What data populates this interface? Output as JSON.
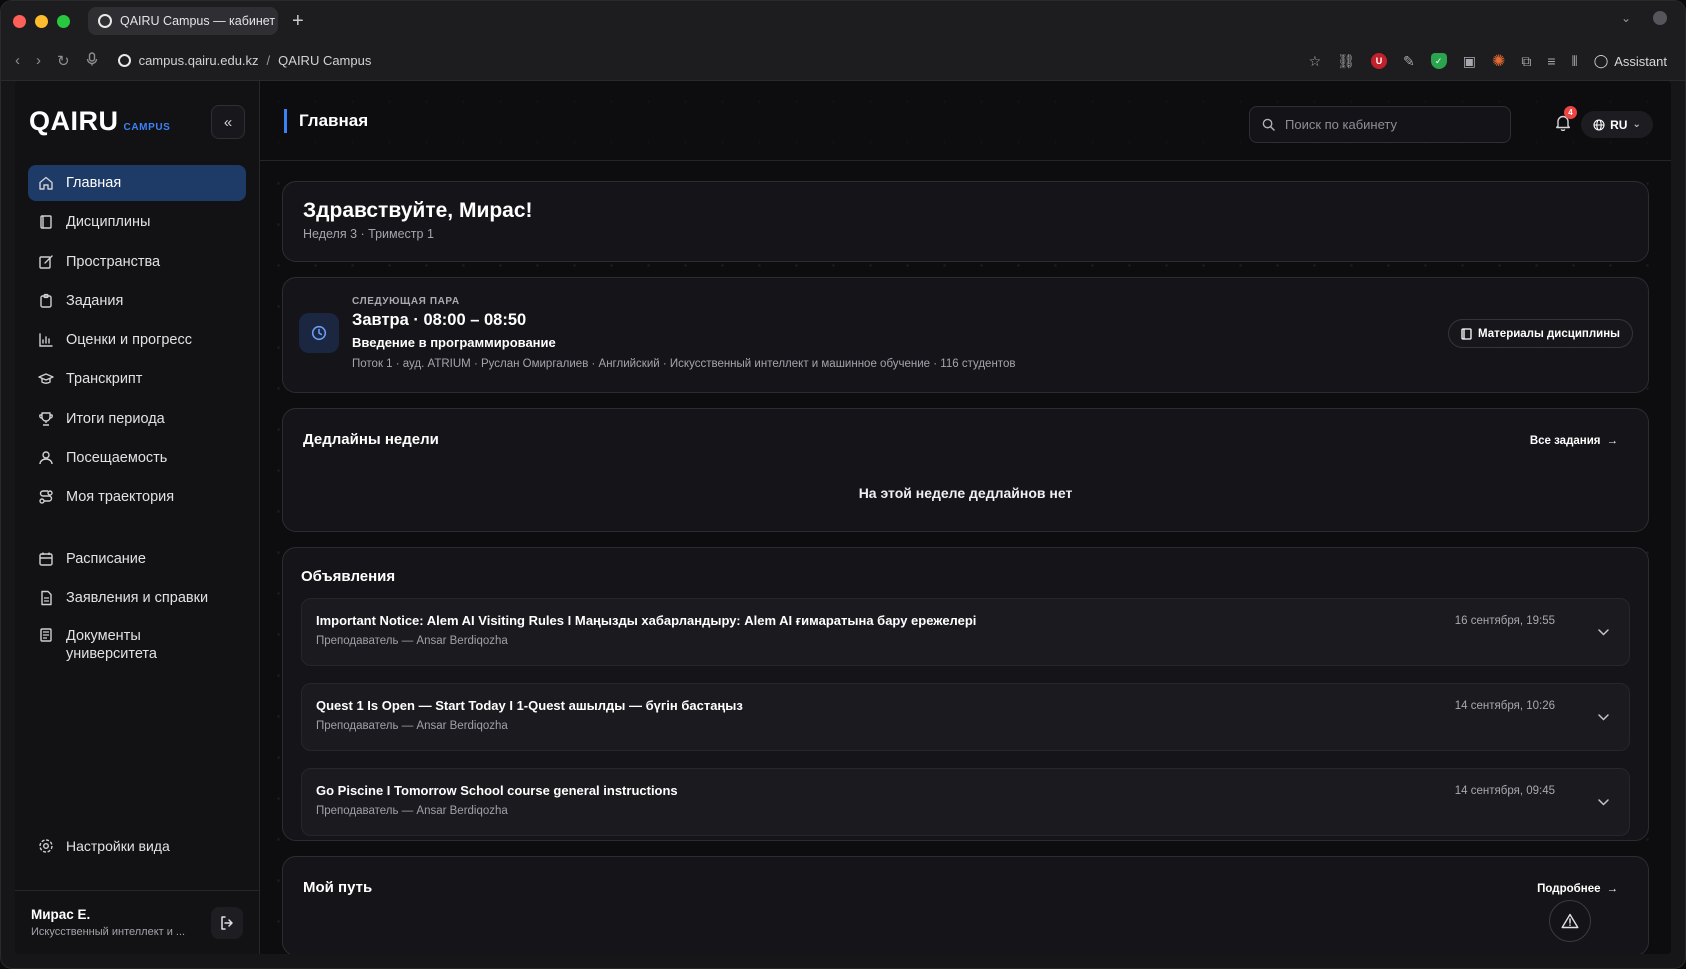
{
  "browser": {
    "tab_title": "QAIRU Campus — кабинет с",
    "url_domain": "campus.qairu.edu.kz",
    "url_separator": "/",
    "url_page": "QAIRU Campus",
    "assistant_label": "Assistant"
  },
  "app": {
    "logo": "QAIRU",
    "logo_sub": "CAMPUS",
    "page_title": "Главная"
  },
  "sidebar": {
    "items": [
      {
        "label": "Главная",
        "icon": "home-icon"
      },
      {
        "label": "Дисциплины",
        "icon": "book-icon"
      },
      {
        "label": "Пространства",
        "icon": "edit-icon"
      },
      {
        "label": "Задания",
        "icon": "clipboard-icon"
      },
      {
        "label": "Оценки и прогресс",
        "icon": "bar-chart-icon"
      },
      {
        "label": "Транскрипт",
        "icon": "graduation-cap-icon"
      },
      {
        "label": "Итоги периода",
        "icon": "trophy-icon"
      },
      {
        "label": "Посещаемость",
        "icon": "user-icon"
      },
      {
        "label": "Моя траектория",
        "icon": "route-icon"
      }
    ],
    "items2": [
      {
        "label": "Расписание",
        "icon": "calendar-icon"
      },
      {
        "label": "Заявления и справки",
        "icon": "file-icon"
      },
      {
        "label": "Документы университета",
        "icon": "library-icon"
      }
    ],
    "settings_label": "Настройки вида",
    "user_name": "Мирас Е.",
    "user_sub": "Искусственный интеллект и ..."
  },
  "header": {
    "search_placeholder": "Поиск по кабинету",
    "notification_count": "4",
    "language": "RU"
  },
  "greeting": {
    "title": "Здравствуйте, Мирас!",
    "subtitle": "Неделя 3 · Триместр 1"
  },
  "next_class": {
    "label": "СЛЕДУЮЩАЯ ПАРА",
    "time": "Завтра · 08:00 – 08:50",
    "course": "Введение в программирование",
    "meta": "Поток 1 · ауд. ATRIUM · Руслан Омиргалиев · Английский · Искусственный интеллект и машинное обучение · 116 студентов",
    "materials_button": "Материалы дисциплины"
  },
  "deadlines": {
    "title": "Дедлайны недели",
    "all_link": "Все задания",
    "empty": "На этой неделе дедлайнов нет"
  },
  "announcements": {
    "title": "Объявления",
    "items": [
      {
        "title": "Important Notice: Alem AI Visiting Rules I Маңызды хабарландыру: Alem AI ғимаратына бару ережелері",
        "author": "Преподаватель — Ansar Berdiqozha",
        "date": "16 сентября, 19:55"
      },
      {
        "title": "Quest 1 Is Open — Start Today I 1-Quest ашылды — бүгін бастаңыз",
        "author": "Преподаватель — Ansar Berdiqozha",
        "date": "14 сентября, 10:26"
      },
      {
        "title": "Go Piscine I Tomorrow School course general instructions",
        "author": "Преподаватель — Ansar Berdiqozha",
        "date": "14 сентября, 09:45"
      }
    ]
  },
  "path": {
    "title": "Мой путь",
    "more_link": "Подробнее"
  },
  "colors": {
    "accent": "#3b82f6",
    "active_nav": "#1e3a66",
    "badge": "#ef4444"
  }
}
